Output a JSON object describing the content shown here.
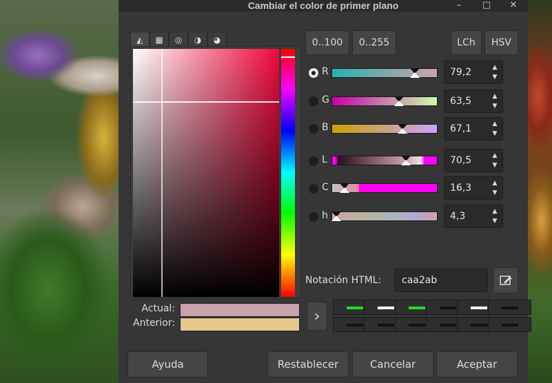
{
  "dialog": {
    "title": "Cambiar el color de primer plano",
    "minimize": "–",
    "maximize": "□",
    "close": "✕"
  },
  "tabs": [
    {
      "name": "wilber-icon",
      "glyph": "◭"
    },
    {
      "name": "cmyk-icon",
      "glyph": "▦"
    },
    {
      "name": "watercolor-icon",
      "glyph": "◎"
    },
    {
      "name": "wheel-icon",
      "glyph": "◑"
    },
    {
      "name": "palette-icon",
      "glyph": "◕"
    }
  ],
  "range_buttons": {
    "percent": "0..100",
    "byte": "0..255"
  },
  "mode_buttons": {
    "lch": "LCh",
    "hsv": "HSV"
  },
  "channels": [
    {
      "label": "R",
      "value": "79,2",
      "selected": true,
      "fraction": 0.792,
      "gradient": "linear-gradient(90deg,#26b2ad 0%,#cfa2ab 100%)"
    },
    {
      "label": "G",
      "value": "63,5",
      "selected": false,
      "fraction": 0.635,
      "gradient": "linear-gradient(90deg,#c900ad 0%,#caffab 100%)"
    },
    {
      "label": "B",
      "value": "67,1",
      "selected": false,
      "fraction": 0.671,
      "gradient": "linear-gradient(90deg,#caa200 0%,#caa2ff 100%)"
    },
    {
      "label": "L",
      "value": "70,5",
      "selected": false,
      "fraction": 0.705,
      "gradient": "linear-gradient(90deg,#ff00ff 0%,#ff00ff 3%,#2a1020 6%,#cfa2ab 70%,#f0e0ea 85%,#ff00ff 88%,#ff00ff 100%)"
    },
    {
      "label": "C",
      "value": "16,3",
      "selected": false,
      "fraction": 0.12,
      "gradient": "linear-gradient(90deg,#c8c0c4 0%,#e08aa0 25%,#ff00f0 26%,#ff00ff 100%)"
    },
    {
      "label": "h",
      "value": "4,3",
      "selected": false,
      "fraction": 0.04,
      "gradient": "linear-gradient(90deg,#cfa2ab 0%,#b8b2a0 30%,#a8b8b8 55%,#b0aad0 80%,#cfa2ab 100%)"
    }
  ],
  "html_notation": {
    "label": "Notación HTML:",
    "value": "caa2ab"
  },
  "swatches": {
    "actual_label": "Actual:",
    "anterior_label": "Anterior:",
    "actual_color": "#caa2ab",
    "anterior_color": "#e3c98b"
  },
  "history_arrow": "›",
  "history": [
    "#22dd22",
    "#ffffff",
    "#22dd22",
    "#111111",
    "#ffffff",
    "#111111",
    "#111111",
    "#111111",
    "#111111",
    "#111111",
    "#111111",
    "#111111"
  ],
  "buttons": {
    "help": "Ayuda",
    "reset": "Restablecer",
    "cancel": "Cancelar",
    "ok": "Aceptar"
  }
}
